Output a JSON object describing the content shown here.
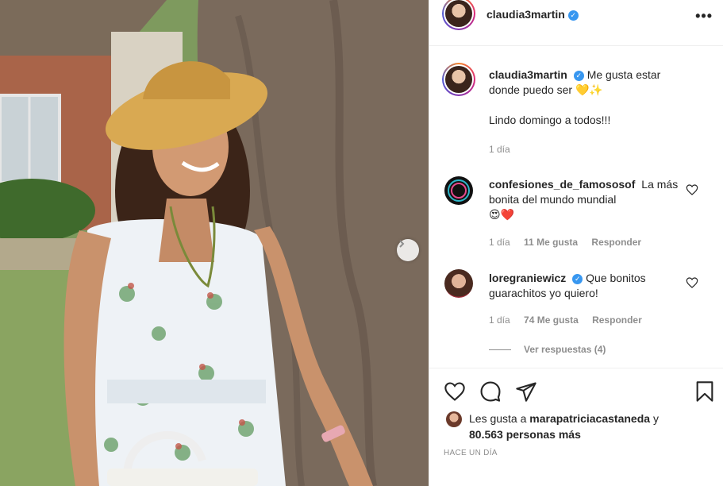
{
  "header": {
    "username": "claudia3martin",
    "verified": true,
    "more_icon": "ellipsis-icon"
  },
  "caption": {
    "username": "claudia3martin",
    "text_line1": "Me gusta estar",
    "text_line2": "donde puedo ser",
    "emojis": "💛✨",
    "text_line3": "Lindo domingo a todos!!!",
    "time": "1 día"
  },
  "comments": [
    {
      "username": "confesiones_de_famososof",
      "text": "La más bonita del mundo mundial",
      "emojis": "😍❤️",
      "time": "1 día",
      "likes": "11 Me gusta",
      "reply_label": "Responder"
    },
    {
      "username": "loregraniewicz",
      "verified": true,
      "text": "Que bonitos guarachitos yo quiero!",
      "time": "1 día",
      "likes": "74 Me gusta",
      "reply_label": "Responder"
    }
  ],
  "view_replies": "Ver respuestas (4)",
  "actions": {
    "like_icon": "heart-icon",
    "comment_icon": "comment-icon",
    "share_icon": "paper-plane-icon",
    "save_icon": "bookmark-icon"
  },
  "likes": {
    "prefix": "Les gusta a",
    "user": "marapatriciacastaneda",
    "connector": "y",
    "count_text": "80.563 personas más"
  },
  "time_ago": "Hace un día",
  "colors": {
    "verified": "#3897f0",
    "heart_red": "#ed4956",
    "muted_text": "#8e8e8e"
  }
}
